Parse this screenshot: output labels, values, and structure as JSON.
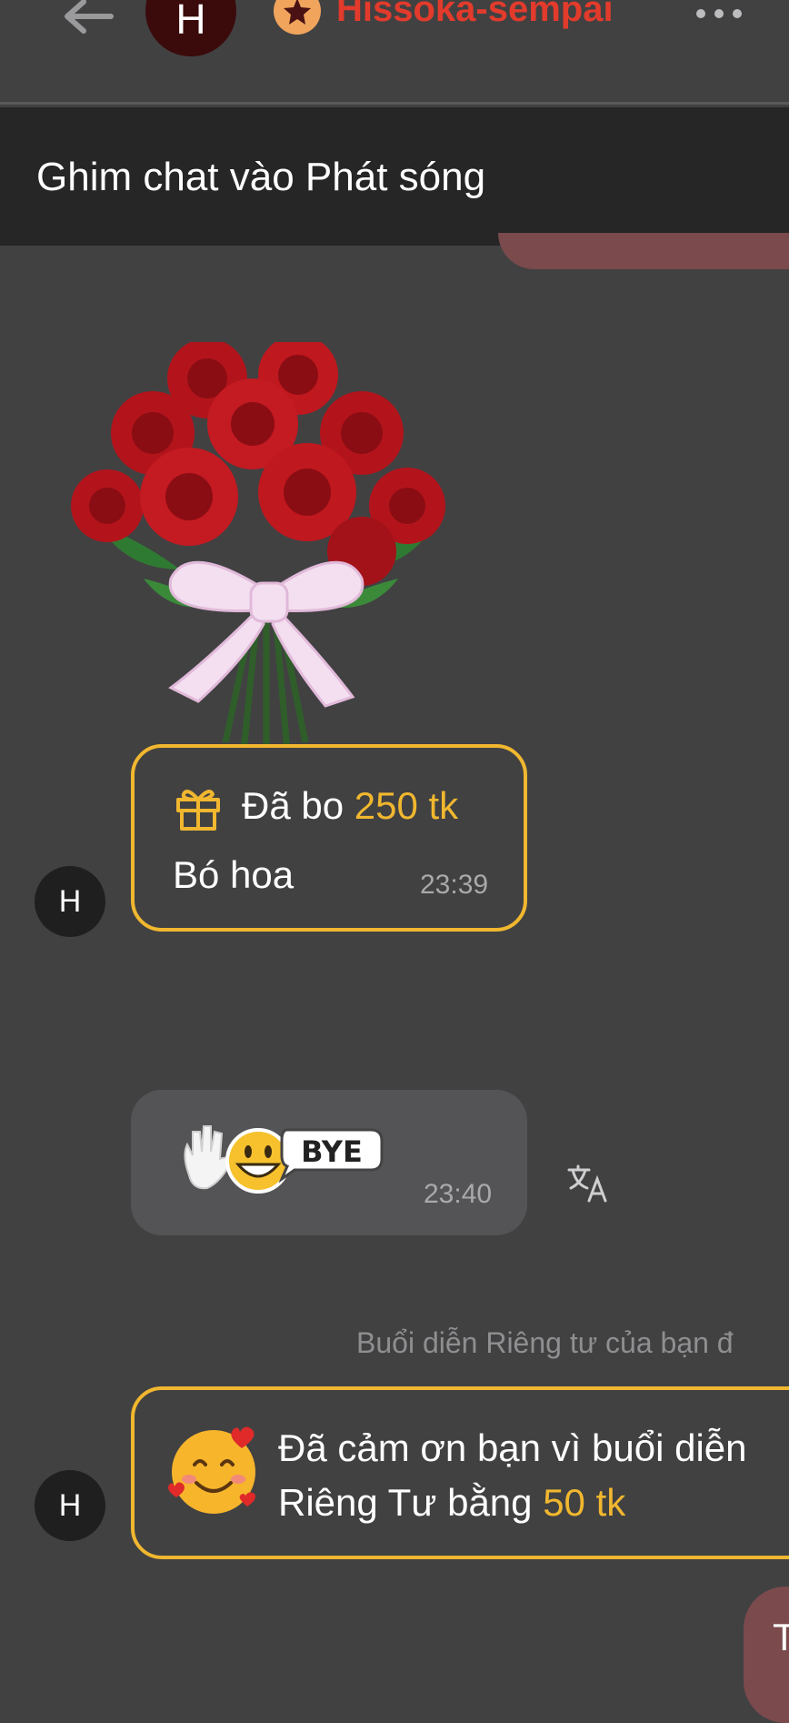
{
  "header": {
    "avatar_initial": "H",
    "username": "Hissoka-sempai",
    "icons": [
      "back-arrow-icon",
      "star-badge-icon",
      "more-icon"
    ]
  },
  "pin_banner": {
    "text": "Ghim chat vào Phát sóng"
  },
  "messages": [
    {
      "type": "gift",
      "avatar_initial": "H",
      "sent_prefix": "Đã bo",
      "amount": "250 tk",
      "gift_name": "Bó hoa",
      "time": "23:39",
      "sticker": "rose-bouquet"
    },
    {
      "type": "sticker",
      "sticker_text": "BYE",
      "time": "23:40",
      "icon": "translate-icon"
    },
    {
      "type": "system",
      "text": "Buổi diễn Riêng tư của bạn đ"
    },
    {
      "type": "thanks",
      "avatar_initial": "H",
      "line1": "Đã cảm ơn bạn vì buổi diễn",
      "line2_prefix": "Riêng Tư bằng",
      "amount": "50 tk"
    },
    {
      "type": "outgoing_partial",
      "text": "T"
    }
  ],
  "colors": {
    "background": "#414142",
    "banner": "#262627",
    "accent_gold": "#f1b72f",
    "username_red": "#e23b2c",
    "outgoing_bubble": "#7a4a4c"
  }
}
